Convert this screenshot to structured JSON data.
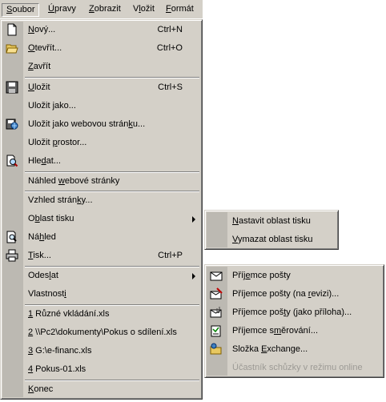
{
  "menubar": {
    "items": [
      {
        "pre": "",
        "u": "S",
        "post": "oubor"
      },
      {
        "pre": "",
        "u": "Ú",
        "post": "pravy"
      },
      {
        "pre": "",
        "u": "Z",
        "post": "obrazit"
      },
      {
        "pre": "V",
        "u": "l",
        "post": "ožit"
      },
      {
        "pre": "",
        "u": "F",
        "post": "ormát"
      }
    ]
  },
  "file_menu": {
    "items": [
      {
        "pre": "",
        "u": "N",
        "post": "ový...",
        "shortcut": "Ctrl+N"
      },
      {
        "pre": "",
        "u": "O",
        "post": "tevřít...",
        "shortcut": "Ctrl+O"
      },
      {
        "pre": "",
        "u": "Z",
        "post": "avřít"
      },
      {
        "pre": "",
        "u": "U",
        "post": "ložit",
        "shortcut": "Ctrl+S"
      },
      {
        "pre": "Uložit ",
        "u": "j",
        "post": "ako..."
      },
      {
        "pre": "Uložit jako webovou strán",
        "u": "k",
        "post": "u..."
      },
      {
        "pre": "Uložit ",
        "u": "p",
        "post": "rostor..."
      },
      {
        "pre": "Hle",
        "u": "d",
        "post": "at..."
      },
      {
        "pre": "Náhled ",
        "u": "w",
        "post": "ebové stránky"
      },
      {
        "pre": "Vzhled strán",
        "u": "k",
        "post": "y..."
      },
      {
        "pre": "O",
        "u": "b",
        "post": "last tisku"
      },
      {
        "pre": "Ná",
        "u": "h",
        "post": "led"
      },
      {
        "pre": "",
        "u": "T",
        "post": "isk...",
        "shortcut": "Ctrl+P"
      },
      {
        "pre": "Odes",
        "u": "l",
        "post": "at"
      },
      {
        "pre": "Vlastnost",
        "u": "i",
        "post": ""
      },
      {
        "pre": "",
        "u": "1",
        "post": " Různé vkládání.xls"
      },
      {
        "pre": "",
        "u": "2",
        "post": " \\\\Pc2\\dokumenty\\Pokus o sdílení.xls"
      },
      {
        "pre": "",
        "u": "3",
        "post": " G:\\e-financ.xls"
      },
      {
        "pre": "",
        "u": "4",
        "post": " Pokus-01.xls"
      },
      {
        "pre": "",
        "u": "K",
        "post": "onec"
      }
    ]
  },
  "print_area_menu": {
    "items": [
      {
        "pre": "",
        "u": "N",
        "post": "astavit oblast tisku"
      },
      {
        "pre": "",
        "u": "V",
        "post": "ymazat oblast tisku"
      }
    ]
  },
  "send_menu": {
    "items": [
      {
        "pre": "Příj",
        "u": "e",
        "post": "mce pošty"
      },
      {
        "pre": "Příjemce pošty (na ",
        "u": "r",
        "post": "evizi)..."
      },
      {
        "pre": "Příjemce poš",
        "u": "t",
        "post": "y (jako příloha)..."
      },
      {
        "pre": "Příjemce s",
        "u": "m",
        "post": "ěrování..."
      },
      {
        "pre": "Složka ",
        "u": "E",
        "post": "xchange..."
      },
      {
        "pre": "Účastník schůzky v režimu online",
        "u": "",
        "post": ""
      }
    ]
  },
  "colors": {
    "menu_bg": "#d4d0c8",
    "gutter": "#bcb9b2",
    "disabled_text": "#9c9a95"
  },
  "icons": [
    "new-document-icon",
    "open-folder-icon",
    "save-disk-icon",
    "save-web-icon",
    "search-icon",
    "print-preview-icon",
    "printer-icon",
    "mail-recipient-icon",
    "mail-review-icon",
    "mail-attachment-icon",
    "routing-slip-icon",
    "exchange-folder-icon"
  ]
}
